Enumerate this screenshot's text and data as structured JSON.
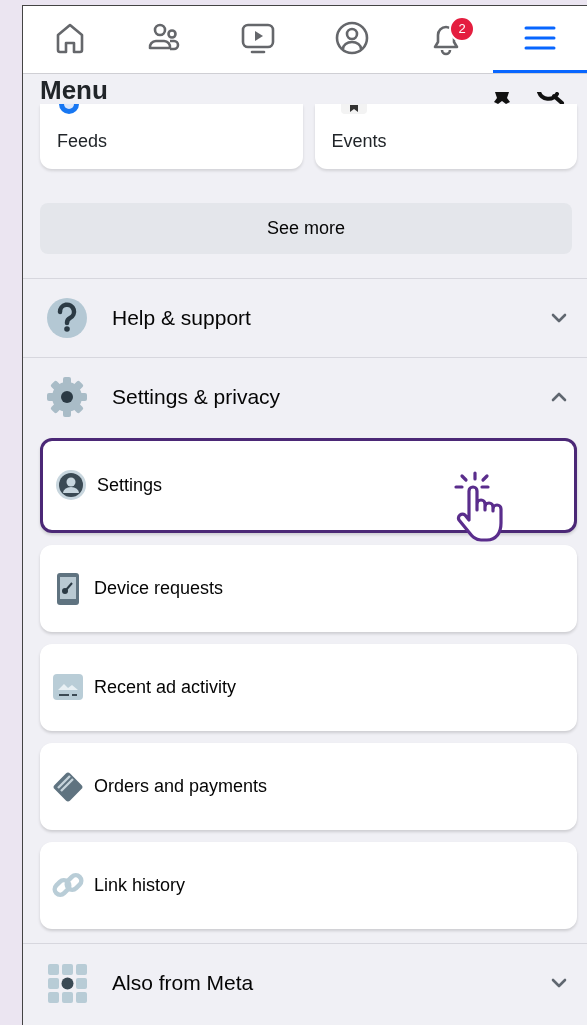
{
  "nav_tabs": [
    {
      "selected": false
    },
    {
      "selected": false
    },
    {
      "selected": false
    },
    {
      "selected": false
    },
    {
      "selected": false,
      "badge": "2"
    },
    {
      "selected": true
    }
  ],
  "heading": "Menu",
  "shortcuts": [
    {
      "label": "Feeds"
    },
    {
      "label": "Events"
    }
  ],
  "see_more": "See more",
  "sections": [
    {
      "title": "Help & support",
      "expanded": false
    },
    {
      "title": "Settings & privacy",
      "expanded": true,
      "items": [
        {
          "label": "Settings",
          "selected": true
        },
        {
          "label": "Device requests",
          "selected": false
        },
        {
          "label": "Recent ad activity",
          "selected": false
        },
        {
          "label": "Orders and payments",
          "selected": false
        },
        {
          "label": "Link history",
          "selected": false
        }
      ]
    },
    {
      "title": "Also from Meta",
      "expanded": false
    }
  ]
}
